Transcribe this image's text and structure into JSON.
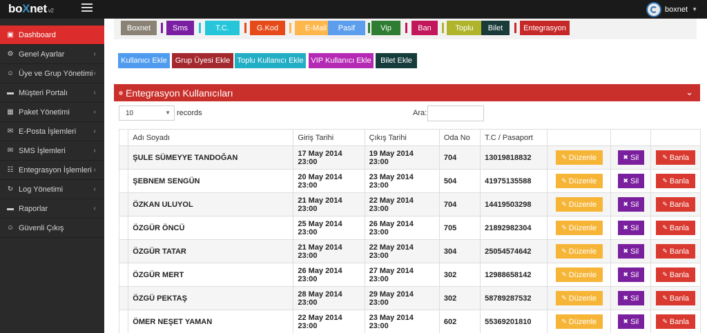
{
  "app": {
    "logo_prefix": "bo",
    "logo_x": "X",
    "logo_suffix": "net",
    "logo_version": "v2",
    "user_name": "boxnet"
  },
  "sidebar": {
    "items": [
      {
        "label": "Dashboard",
        "icon": "dashboard-icon"
      },
      {
        "label": "Genel Ayarlar",
        "icon": "cogs-icon"
      },
      {
        "label": "Üye ve Grup Yönetimi",
        "icon": "user-icon"
      },
      {
        "label": "Müşteri Portalı",
        "icon": "folder-icon"
      },
      {
        "label": "Paket Yönetimi",
        "icon": "table-icon"
      },
      {
        "label": "E-Posta İşlemleri",
        "icon": "envelope-icon"
      },
      {
        "label": "SMS İşlemleri",
        "icon": "envelope-icon"
      },
      {
        "label": "Entegrasyon İşlemleri",
        "icon": "sitemap-icon"
      },
      {
        "label": "Log Yönetimi",
        "icon": "log-icon"
      },
      {
        "label": "Raporlar",
        "icon": "folder-icon"
      },
      {
        "label": "Güvenli Çıkış",
        "icon": "user-icon"
      }
    ]
  },
  "tabs": [
    {
      "label": "Boxnet",
      "color": "#8a8275",
      "sep": "#7b1fa2"
    },
    {
      "label": "Sms",
      "color": "#7b1fa2",
      "sep": "#26c6da"
    },
    {
      "label": "T.C.",
      "color": "#26c6da",
      "sep": "#e64a19"
    },
    {
      "label": "G.Kod",
      "color": "#e64a19",
      "sep": "#ffb74d"
    },
    {
      "label": "E-Mail",
      "color": "#ffb74d",
      "sep": "#5c9ded"
    },
    {
      "label": "Pasif",
      "color": "#5c9ded",
      "sep": "#2e7d32"
    },
    {
      "label": "Vip",
      "color": "#2e7d32",
      "sep": "#c2185b"
    },
    {
      "label": "Ban",
      "color": "#c2185b",
      "sep": "#afb42b"
    },
    {
      "label": "Toplu",
      "color": "#afb42b",
      "sep": "#1b3b3b"
    },
    {
      "label": "Bilet",
      "color": "#1b3b3b",
      "sep": "#c62828"
    },
    {
      "label": "Entegrasyon",
      "color": "#c62828",
      "sep": ""
    }
  ],
  "actions": [
    {
      "label": "Kullanıcı Ekle",
      "color": "#4f9bf0"
    },
    {
      "label": "Grup Üyesi Ekle",
      "color": "#a3292e"
    },
    {
      "label": "Toplu Kullanıcı Ekle",
      "color": "#22aec4"
    },
    {
      "label": "VIP Kullanıcı Ekle",
      "color": "#b52ab5"
    },
    {
      "label": "Bilet Ekle",
      "color": "#173c3c"
    }
  ],
  "panel": {
    "title": "Entegrasyon Kullanıcıları",
    "collapse_icon": "chevron-down-icon"
  },
  "table_controls": {
    "page_length": "10",
    "records_label": "records",
    "search_label": "Ara:",
    "search_value": ""
  },
  "table": {
    "headers": [
      "",
      "Adı Soyadı",
      "Giriş Tarihi",
      "Çıkış Tarihi",
      "Oda No",
      "T.C / Pasaport",
      "",
      "",
      ""
    ],
    "buttons": {
      "edit": "Düzenle",
      "delete": "Sil",
      "ban": "Banla"
    },
    "rows": [
      {
        "name": "ŞULE SÜMEYYE TANDOĞAN",
        "checkin": "17 May 2014 23:00",
        "checkout": "19 May 2014 23:00",
        "room": "704",
        "id": "13019818832"
      },
      {
        "name": "ŞEBNEM SENGÜN",
        "checkin": "20 May 2014 23:00",
        "checkout": "23 May 2014 23:00",
        "room": "504",
        "id": "41975135588"
      },
      {
        "name": "ÖZKAN ULUYOL",
        "checkin": "21 May 2014 23:00",
        "checkout": "22 May 2014 23:00",
        "room": "704",
        "id": "14419503298"
      },
      {
        "name": "ÖZGÜR ÖNCÜ",
        "checkin": "25 May 2014 23:00",
        "checkout": "26 May 2014 23:00",
        "room": "705",
        "id": "21892982304"
      },
      {
        "name": "ÖZGÜR TATAR",
        "checkin": "21 May 2014 23:00",
        "checkout": "22 May 2014 23:00",
        "room": "304",
        "id": "25054574642"
      },
      {
        "name": "ÖZGÜR MERT",
        "checkin": "26 May 2014 23:00",
        "checkout": "27 May 2014 23:00",
        "room": "302",
        "id": "12988658142"
      },
      {
        "name": "ÖZGÜ PEKTAŞ",
        "checkin": "28 May 2014 23:00",
        "checkout": "29 May 2014 23:00",
        "room": "302",
        "id": "58789287532"
      },
      {
        "name": "ÖMER NEŞET YAMAN",
        "checkin": "22 May 2014 23:00",
        "checkout": "23 May 2014 23:00",
        "room": "602",
        "id": "55369201810"
      }
    ]
  }
}
